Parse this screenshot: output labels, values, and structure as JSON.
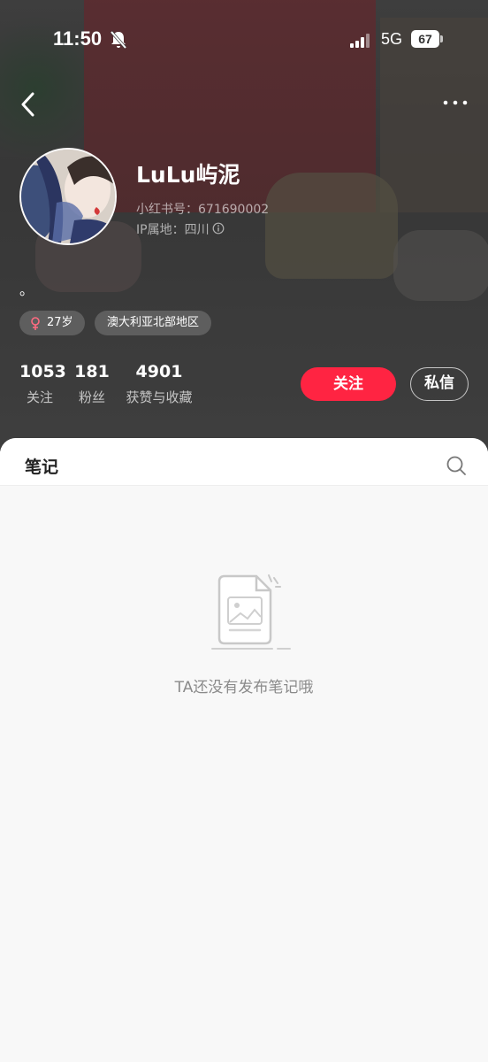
{
  "status_bar": {
    "time": "11:50",
    "network": "5G",
    "battery": "67",
    "icons": [
      "bell-muted-icon",
      "signal-icon",
      "battery-icon"
    ]
  },
  "nav": {
    "back_icon": "chevron-left-icon",
    "more_icon": "more-dots-icon"
  },
  "profile": {
    "username": "LuLu屿泥",
    "red_id": "小红书号：671690002",
    "ip_location": "IP属地：四川",
    "bio": "。",
    "tags": [
      {
        "icon": "female-icon",
        "label": "27岁",
        "icon_color": "#ff6b81"
      },
      {
        "label": "澳大利亚北部地区"
      }
    ],
    "stats": [
      {
        "value": "1053",
        "label": "关注"
      },
      {
        "value": "181",
        "label": "粉丝"
      },
      {
        "value": "4901",
        "label": "获赞与收藏"
      }
    ],
    "follow_label": "关注",
    "message_label": "私信",
    "accent_color": "#ff2442"
  },
  "content": {
    "tab_label": "笔记",
    "search_icon": "search-icon",
    "empty_text": "TA还没有发布笔记哦"
  }
}
